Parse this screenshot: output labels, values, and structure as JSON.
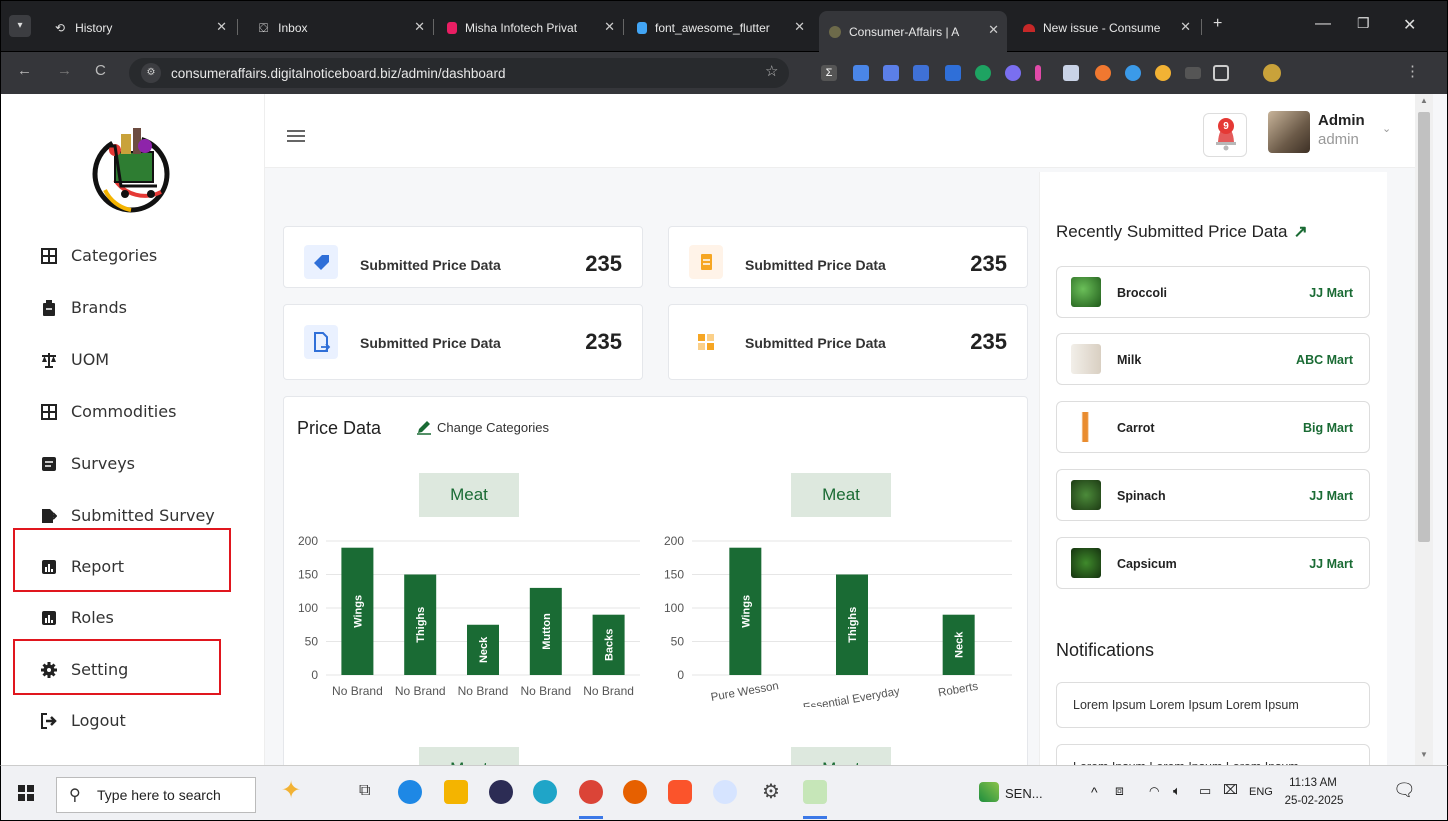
{
  "browser": {
    "tabs": [
      {
        "title": "History"
      },
      {
        "title": "Inbox"
      },
      {
        "title": "Misha Infotech Privat"
      },
      {
        "title": "font_awesome_flutter"
      },
      {
        "title": "Consumer-Affairs | A"
      },
      {
        "title": "New issue - Consume"
      }
    ],
    "url": "consumeraffairs.digitalnoticeboard.biz/admin/dashboard"
  },
  "sidebar": {
    "items": [
      {
        "label": "Categories",
        "icon": "table-icon"
      },
      {
        "label": "Brands",
        "icon": "clipboard-icon"
      },
      {
        "label": "UOM",
        "icon": "scale-icon"
      },
      {
        "label": "Commodities",
        "icon": "table-icon"
      },
      {
        "label": "Surveys",
        "icon": "list-icon"
      },
      {
        "label": "Submitted Survey",
        "icon": "file-export-icon"
      },
      {
        "label": "Report",
        "icon": "chart-icon"
      },
      {
        "label": "Roles",
        "icon": "chart-icon"
      },
      {
        "label": "Setting",
        "icon": "gear-icon"
      },
      {
        "label": "Logout",
        "icon": "logout-icon"
      }
    ]
  },
  "header": {
    "notification_count": "9",
    "user_name": "Admin",
    "user_role": "admin"
  },
  "stats": [
    {
      "label": "Submitted Price Data",
      "value": "235",
      "color": "#2f6fd8"
    },
    {
      "label": "Submitted Price Data",
      "value": "235",
      "color": "#f6a623"
    },
    {
      "label": "Submitted Price Data",
      "value": "235",
      "color": "#2f6fd8"
    },
    {
      "label": "Submitted Price Data",
      "value": "235",
      "color": "#f6a623"
    }
  ],
  "price_panel": {
    "title": "Price Data",
    "change_label": "Change Categories",
    "chip_labels": [
      "Meat",
      "Meat",
      "Meat",
      "Meat"
    ]
  },
  "chart_data": [
    {
      "type": "bar",
      "title": "Meat",
      "categories": [
        "No Brand",
        "No Brand",
        "No Brand",
        "No Brand",
        "No Brand"
      ],
      "bar_labels": [
        "Wings",
        "Thighs",
        "Neck",
        "Mutton",
        "Backs"
      ],
      "values": [
        190,
        150,
        75,
        130,
        90
      ],
      "ylim": [
        0,
        200
      ],
      "yticks": [
        0,
        50,
        100,
        150,
        200
      ],
      "color": "#1a6b34"
    },
    {
      "type": "bar",
      "title": "Meat",
      "categories": [
        "Pure Wesson",
        "Essential Everyday",
        "Roberts"
      ],
      "bar_labels": [
        "Wings",
        "Thighs",
        "Neck"
      ],
      "values": [
        190,
        150,
        90
      ],
      "ylim": [
        0,
        200
      ],
      "yticks": [
        0,
        50,
        100,
        150,
        200
      ],
      "color": "#1a6b34"
    }
  ],
  "recent": {
    "title": "Recently Submitted Price Data",
    "items": [
      {
        "name": "Broccoli",
        "store": "JJ Mart"
      },
      {
        "name": "Milk",
        "store": "ABC Mart"
      },
      {
        "name": "Carrot",
        "store": "Big Mart"
      },
      {
        "name": "Spinach",
        "store": "JJ Mart"
      },
      {
        "name": "Capsicum",
        "store": "JJ Mart"
      }
    ]
  },
  "notifications": {
    "title": "Notifications",
    "items": [
      "Lorem Ipsum Lorem Ipsum Lorem Ipsum",
      "Lorem Ipsum Lorem Ipsum Lorem Ipsum"
    ]
  },
  "taskbar": {
    "search_placeholder": "Type here to search",
    "sen_label": "SEN...",
    "lang": "ENG",
    "time": "11:13 AM",
    "date": "25-02-2025"
  }
}
